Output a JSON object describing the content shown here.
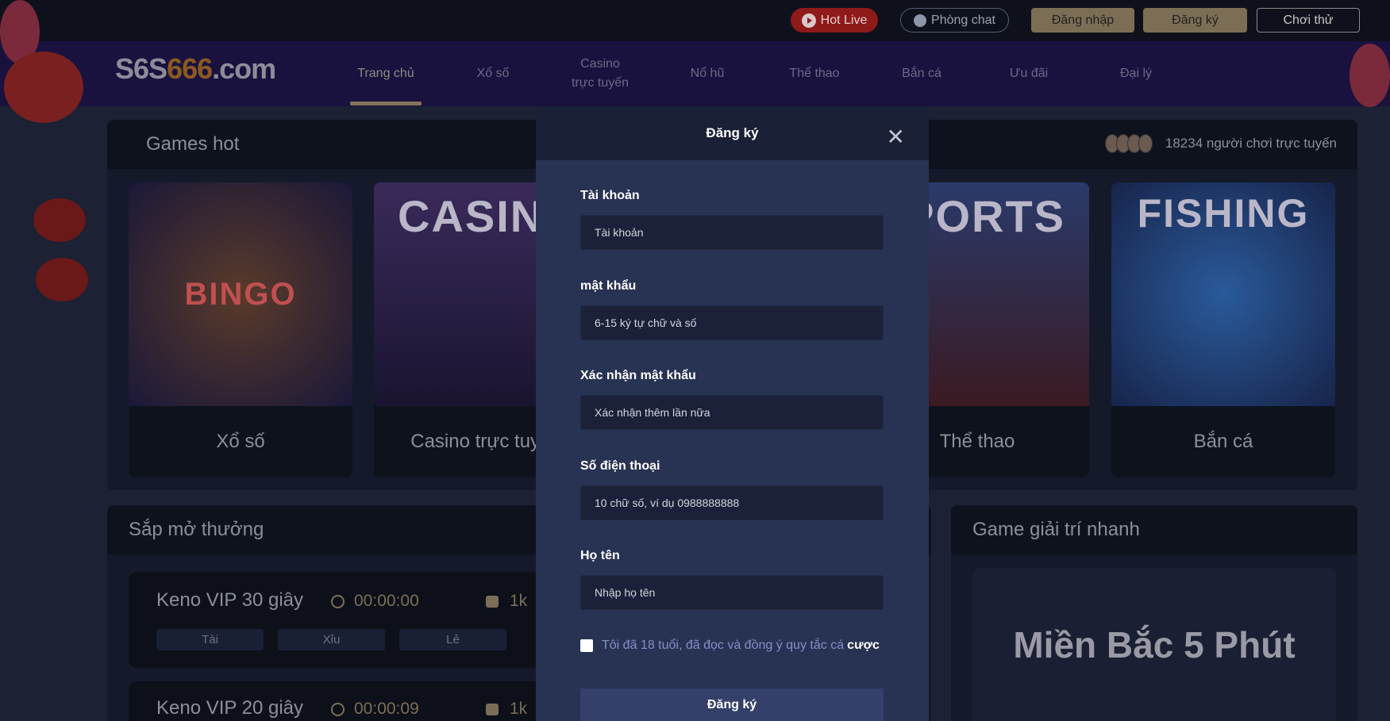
{
  "header": {
    "hot_live": "Hot Live",
    "chat": "Phòng chat",
    "login": "Đăng nhập",
    "register": "Đăng ký",
    "trial": "Chơi thử"
  },
  "logo": {
    "text_a": "S",
    "text_b": "666",
    ".com": ".com",
    "text_c": ".com"
  },
  "nav": [
    {
      "label": "Trang chủ",
      "active": true
    },
    {
      "label": "Xổ số"
    },
    {
      "label": "Casino trực tuyến"
    },
    {
      "label": "Nổ hũ"
    },
    {
      "label": "Thể thao"
    },
    {
      "label": "Bắn cá"
    },
    {
      "label": "Ưu đãi"
    },
    {
      "label": "Đại lý"
    }
  ],
  "games_hot": {
    "title": "Games hot",
    "online": "18234 người chơi trực tuyến",
    "cards": [
      {
        "label": "Xổ số",
        "art": "BINGO"
      },
      {
        "label": "Casino trực tuyến",
        "art": "CASINO"
      },
      {
        "label": "Thể thao",
        "art": "SPORTS"
      },
      {
        "label": "Bắn cá",
        "art": "FISHING"
      }
    ]
  },
  "upcoming": {
    "title": "Sắp mở thưởng",
    "rows": [
      {
        "name": "Keno VIP 30 giây",
        "time": "00:00:00",
        "amount": "1k",
        "options": [
          "Tài",
          "Xỉu",
          "Lẻ"
        ]
      },
      {
        "name": "Keno VIP 20 giây",
        "time": "00:00:09",
        "amount": "1k"
      }
    ]
  },
  "quick": {
    "title": "Game giải trí nhanh",
    "banner": "Miền Bắc 5 Phút"
  },
  "modal": {
    "title": "Đăng ký",
    "fields": [
      {
        "label": "Tài khoản",
        "placeholder": "Tài khoản"
      },
      {
        "label": "mật khẩu",
        "placeholder": "6-15 ký tự chữ và số"
      },
      {
        "label": "Xác nhận mật khẩu",
        "placeholder": "Xác nhận thêm lần nữa"
      },
      {
        "label": "Số điện thoại",
        "placeholder": "10 chữ số, ví dụ 0988888888"
      },
      {
        "label": "Họ tên",
        "placeholder": "Nhập họ tên"
      }
    ],
    "agree": "Tôi đã 18 tuổi, đã đọc và đồng ý quy tắc cá",
    "agree_bold": "cược",
    "agree_checked": false,
    "submit": "Đăng ký"
  },
  "colors": {
    "accent": "#7b6e55",
    "hot": "#8e1a1a",
    "modal_bg": "#283252"
  }
}
